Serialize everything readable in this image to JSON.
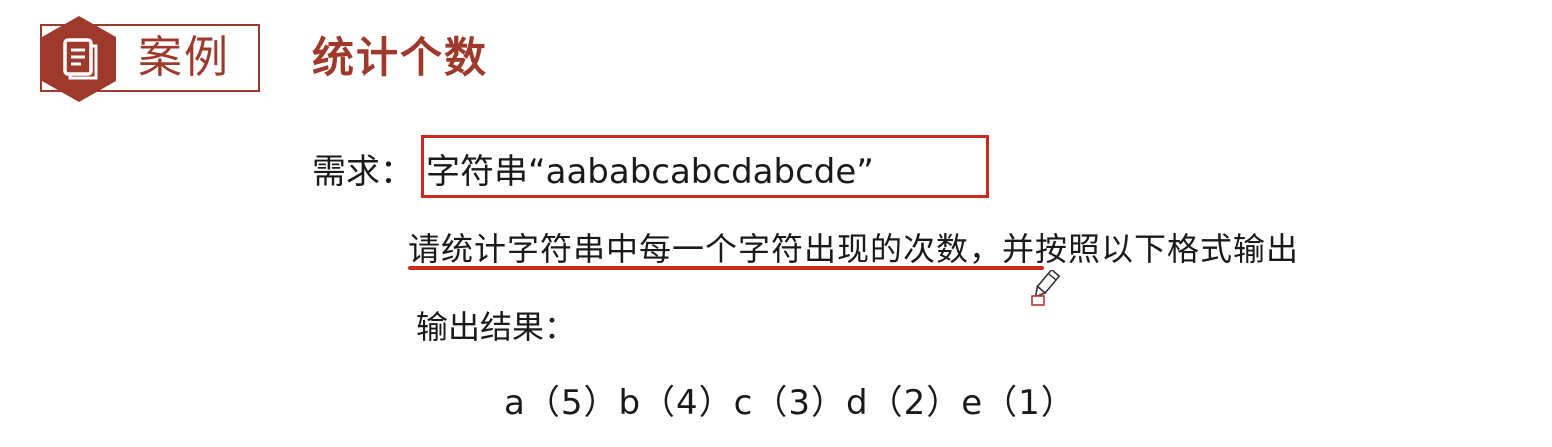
{
  "header": {
    "badge_icon": "document-icon",
    "badge_label": "案例",
    "title": "统计个数",
    "accent_color": "#9e3a2c"
  },
  "content": {
    "requirement_label": "需求：",
    "requirement_text": "字符串“aababcabcdabcde”",
    "task_text": "请统计字符串中每一个字符出现的次数，并按照以下格式输出",
    "output_label": "输出结果：",
    "output_result": "a（5）b（4）c（3）d（2）e（1）",
    "highlight_color": "#cc2a1e"
  }
}
